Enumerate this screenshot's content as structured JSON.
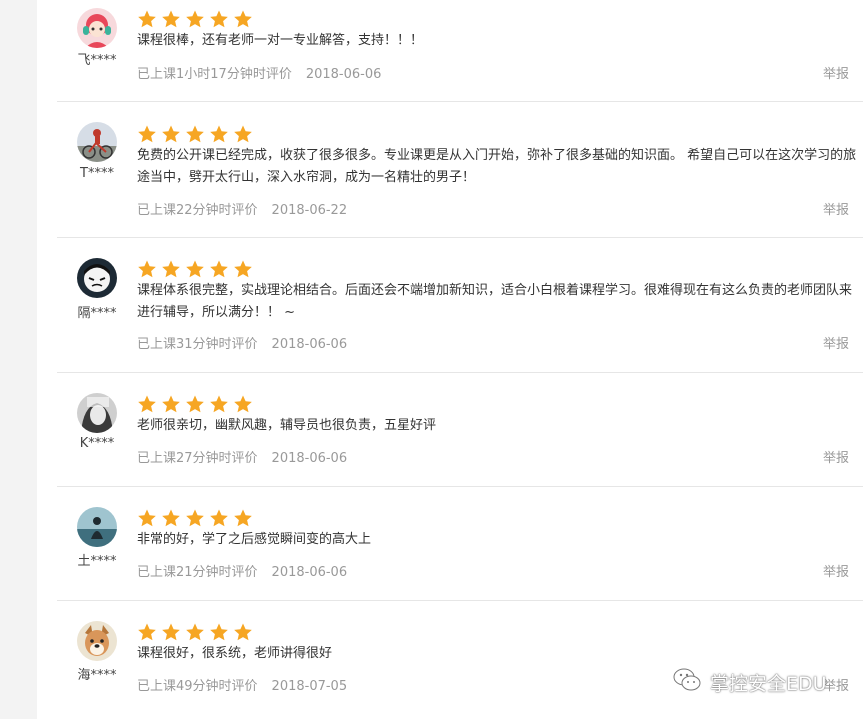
{
  "colors": {
    "star": "#f6a623",
    "muted": "#999999",
    "divider": "#e6e6e6"
  },
  "reviews": [
    {
      "user": "飞****",
      "rating": 5,
      "text": "课程很棒，还有老师一对一专业解答，支持！！！",
      "duration": "已上课1小时17分钟时评价",
      "date": "2018-06-06",
      "report": "举报",
      "avatar_icon": "girl-with-headphones-avatar"
    },
    {
      "user": "T****",
      "rating": 5,
      "text": "免费的公开课已经完成，收获了很多很多。专业课更是从入门开始，弥补了很多基础的知识面。 希望自己可以在这次学习的旅途当中，劈开太行山，深入水帘洞，成为一名精壮的男子！",
      "duration": "已上课22分钟时评价",
      "date": "2018-06-22",
      "report": "举报",
      "avatar_icon": "cyclist-avatar"
    },
    {
      "user": "隔****",
      "rating": 5,
      "text": "课程体系很完整，实战理论相结合。后面还会不端增加新知识，适合小白根着课程学习。很难得现在有这么负责的老师团队来进行辅导，所以满分！！ ~",
      "duration": "已上课31分钟时评价",
      "date": "2018-06-06",
      "report": "举报",
      "avatar_icon": "cartoon-face-avatar"
    },
    {
      "user": "K****",
      "rating": 5,
      "text": "老师很亲切，幽默风趣，辅导员也很负责，五星好评",
      "duration": "已上课27分钟时评价",
      "date": "2018-06-06",
      "report": "举报",
      "avatar_icon": "grayscale-portrait-avatar"
    },
    {
      "user": "土****",
      "rating": 5,
      "text": "非常的好，学了之后感觉瞬间变的高大上",
      "duration": "已上课21分钟时评价",
      "date": "2018-06-06",
      "report": "举报",
      "avatar_icon": "seaside-silhouette-avatar"
    },
    {
      "user": "海****",
      "rating": 5,
      "text": "课程很好，很系统，老师讲得很好",
      "duration": "已上课49分钟时评价",
      "date": "2018-07-05",
      "report": "举报",
      "avatar_icon": "dog-avatar"
    }
  ],
  "watermark": {
    "text": "掌控安全EDU",
    "icon": "wechat-icon"
  }
}
